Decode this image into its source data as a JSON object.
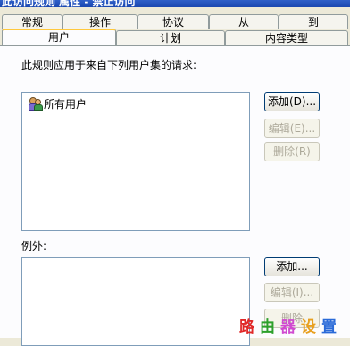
{
  "window": {
    "title": "此访问规则 属性 - 禁止访问"
  },
  "tabs_back": [
    {
      "label": "常规"
    },
    {
      "label": "操作"
    },
    {
      "label": "协议"
    },
    {
      "label": "从"
    },
    {
      "label": "到"
    }
  ],
  "tabs_front": [
    {
      "label": "用户"
    },
    {
      "label": "计划"
    },
    {
      "label": "内容类型"
    }
  ],
  "main": {
    "apply_label": "此规则应用于来自下列用户集的请求:",
    "users_list": [
      {
        "label": "所有用户"
      }
    ],
    "users_buttons": {
      "add": "添加(D)...",
      "edit": "编辑(E)...",
      "remove": "删除(R)"
    },
    "exceptions_label": "例外:",
    "exceptions_buttons": {
      "add": "添加...",
      "edit": "编辑(I)...",
      "remove": "删除"
    }
  },
  "watermark": [
    "路",
    "由",
    "器",
    "设",
    "置"
  ],
  "colors": {
    "accent": "#ffc83c",
    "border": "#919b9c",
    "background": "#ece9d8"
  }
}
